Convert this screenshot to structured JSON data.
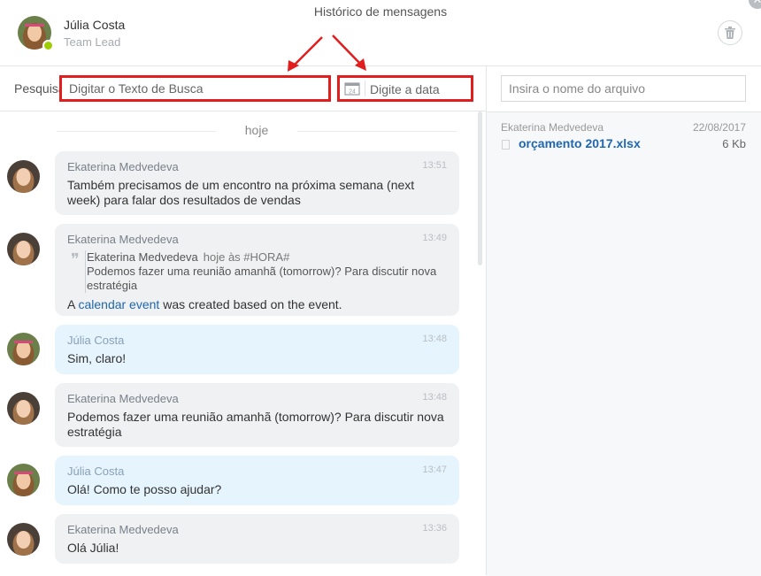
{
  "window": {
    "title": "Histórico de mensagens"
  },
  "header": {
    "name": "Júlia Costa",
    "role": "Team Lead"
  },
  "search": {
    "label": "Pesquisar",
    "placeholder": "Digitar o Texto de Busca",
    "date_placeholder": "Digite a data",
    "calendar_day": "24"
  },
  "files": {
    "search_placeholder": "Insira o nome do arquivo",
    "items": [
      {
        "sender": "Ekaterina Medvedeva",
        "date": "22/08/2017",
        "name": "orçamento 2017.xlsx",
        "size": "6 Kb"
      }
    ]
  },
  "chat": {
    "day_label": "hoje",
    "messages": [
      {
        "author": "Ekaterina Medvedeva",
        "time": "13:51",
        "text": "Também precisamos de um encontro na próxima semana (next week) para falar dos resultados de vendas"
      },
      {
        "author": "Ekaterina Medvedeva",
        "time": "13:49",
        "quote": {
          "author": "Ekaterina Medvedeva",
          "time": "hoje às #HORA#",
          "text": "Podemos fazer uma reunião amanhã (tomorrow)? Para discutir nova estratégia"
        },
        "text_prefix": "A ",
        "link": "calendar event",
        "text_suffix": " was created based on the event."
      },
      {
        "author": "Júlia Costa",
        "time": "13:48",
        "text": "Sim, claro!"
      },
      {
        "author": "Ekaterina Medvedeva",
        "time": "13:48",
        "text": "Podemos fazer uma reunião amanhã (tomorrow)? Para discutir nova estratégia"
      },
      {
        "author": "Júlia Costa",
        "time": "13:47",
        "text": "Olá! Como te posso ajudar?"
      },
      {
        "author": "Ekaterina Medvedeva",
        "time": "13:36",
        "text": "Olá Júlia!"
      }
    ]
  },
  "colors": {
    "annotation": "#e11d1d",
    "link": "#2067b0",
    "own_bubble": "#e5f4fd",
    "other_bubble": "#f0f1f3",
    "online": "#9dcf00"
  }
}
